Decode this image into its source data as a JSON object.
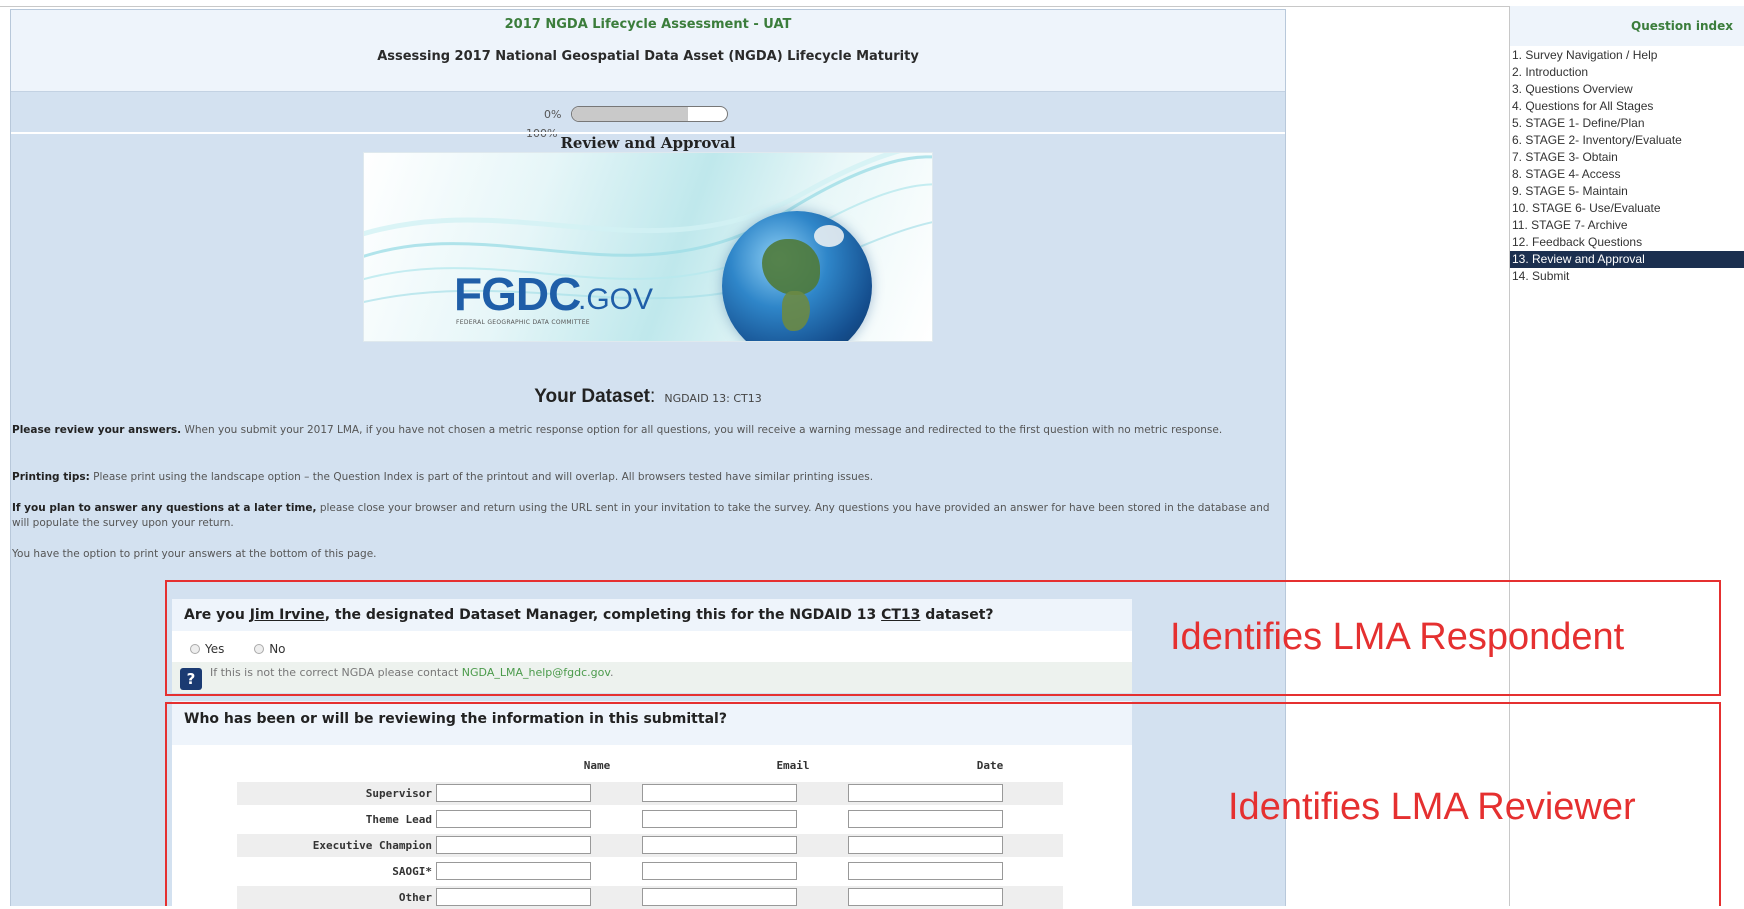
{
  "survey": {
    "title": "2017 NGDA Lifecycle Assessment - UAT",
    "subtitle": "Assessing 2017 National Geospatial Data Asset (NGDA) Lifecycle Maturity"
  },
  "progress": {
    "start_label": "0%",
    "end_label": "100%",
    "value_percent": 75
  },
  "section_title": "Review and Approval",
  "banner": {
    "brand_main": "FGDC",
    "brand_suffix": ".GOV",
    "brand_sub": "FEDERAL GEOGRAPHIC DATA COMMITTEE"
  },
  "dataset": {
    "label": "Your Dataset",
    "colon": ":",
    "value": "NGDAID 13: CT13"
  },
  "instructions": {
    "review_bold": "Please review your answers.",
    "review_text": " When you submit your 2017 LMA, if you have not chosen a metric response option for all questions, you will receive a warning message and redirected to the first question with no metric response.",
    "printing_bold": "Printing tips:",
    "printing_text": " Please print using the landscape option – the Question Index is part of the printout and will overlap. All browsers tested have similar printing issues.",
    "later_bold": "If you plan to answer any questions at a later time,",
    "later_text": " please close your browser and return using the URL sent in your invitation to take the survey. Any questions you have provided an answer for have been stored in the database and will populate the survey upon your return.",
    "print_option": "You have the option to print your answers at the bottom of this page."
  },
  "question1": {
    "prefix": "Are you ",
    "name": "Jim Irvine",
    "middle": ", the designated Dataset Manager, completing this for the NGDAID 13 ",
    "code": "CT13",
    "suffix": " dataset?",
    "option_yes": "Yes",
    "option_no": "No",
    "help_text": "If this is not the correct NGDA please contact ",
    "help_email": "NGDA_LMA_help@fgdc.gov",
    "help_end": "."
  },
  "question2": {
    "text": "Who has been or will be reviewing the information in this submittal?",
    "columns": [
      "Name",
      "Email",
      "Date"
    ],
    "rows": [
      {
        "label": "Supervisor"
      },
      {
        "label": "Theme Lead"
      },
      {
        "label": "Executive Champion"
      },
      {
        "label": "SAOGI*"
      },
      {
        "label": "Other"
      }
    ]
  },
  "annotations": {
    "respondent": "Identifies LMA Respondent",
    "reviewer": "Identifies LMA Reviewer",
    "color": "#e53030"
  },
  "question_index": {
    "title": "Question index",
    "items": [
      {
        "label": "1. Survey Navigation / Help"
      },
      {
        "label": "2. Introduction"
      },
      {
        "label": "3. Questions Overview"
      },
      {
        "label": "4. Questions for All Stages"
      },
      {
        "label": "5. STAGE 1- Define/Plan"
      },
      {
        "label": "6. STAGE 2- Inventory/Evaluate"
      },
      {
        "label": "7. STAGE 3- Obtain"
      },
      {
        "label": "8. STAGE 4- Access"
      },
      {
        "label": "9. STAGE 5- Maintain"
      },
      {
        "label": "10. STAGE 6- Use/Evaluate"
      },
      {
        "label": "11. STAGE 7- Archive"
      },
      {
        "label": "12. Feedback Questions"
      },
      {
        "label": "13. Review and Approval",
        "active": true
      },
      {
        "label": "14. Submit"
      }
    ]
  },
  "colors": {
    "accent_green": "#3b7d3b",
    "panel_blue": "#d3e1f0",
    "active_index": "#1b2f4f"
  }
}
